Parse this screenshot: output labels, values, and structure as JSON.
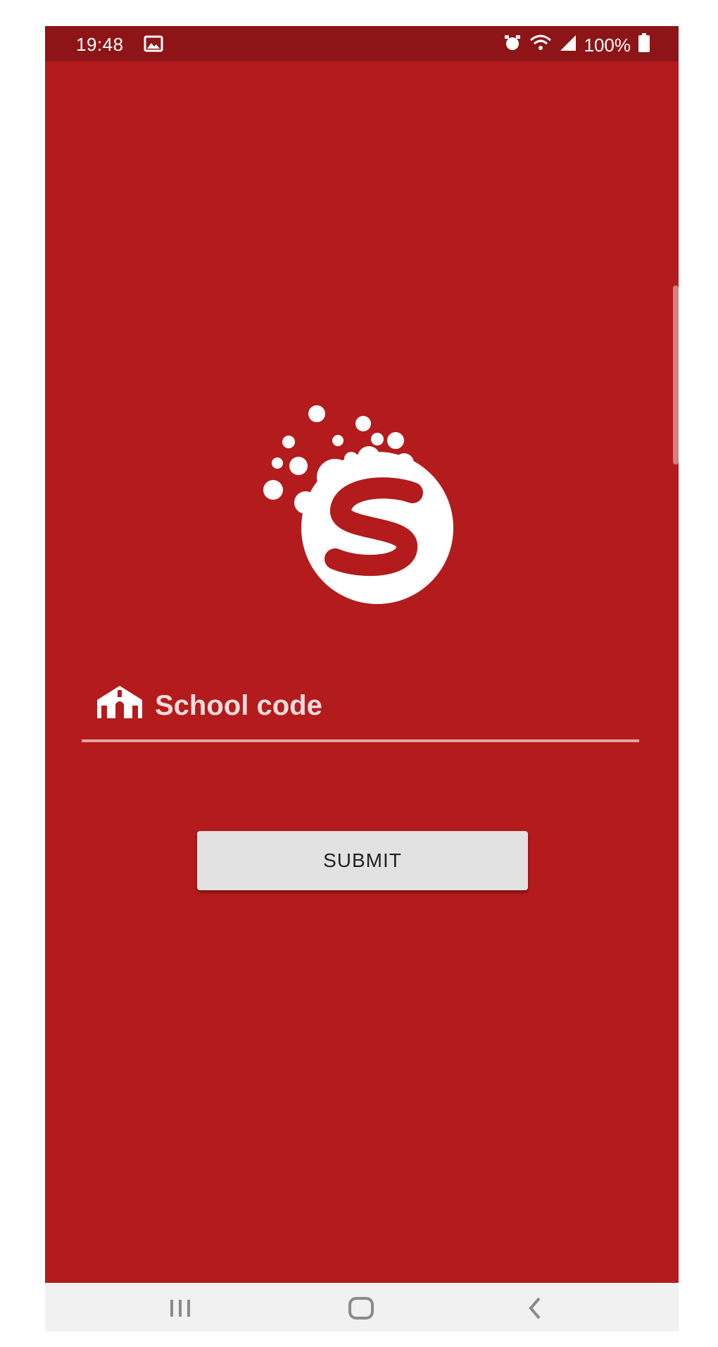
{
  "status_bar": {
    "time": "19:48",
    "battery": "100%",
    "icons": [
      "gallery-icon",
      "alarm-icon",
      "wifi-icon",
      "signal-icon",
      "battery-icon"
    ]
  },
  "logo": {
    "name": "s-logo",
    "color": "#ffffff"
  },
  "school_field": {
    "icon": "school-icon",
    "placeholder": "School code",
    "value": ""
  },
  "submit": {
    "label": "SUBMIT"
  },
  "nav_bar": {
    "icons": [
      "recents-icon",
      "home-icon",
      "back-icon"
    ]
  },
  "colors": {
    "background": "#b31b1c",
    "status_bar": "#8e1517",
    "button": "#e2e2e2",
    "nav_bar": "#f1f1f1"
  }
}
